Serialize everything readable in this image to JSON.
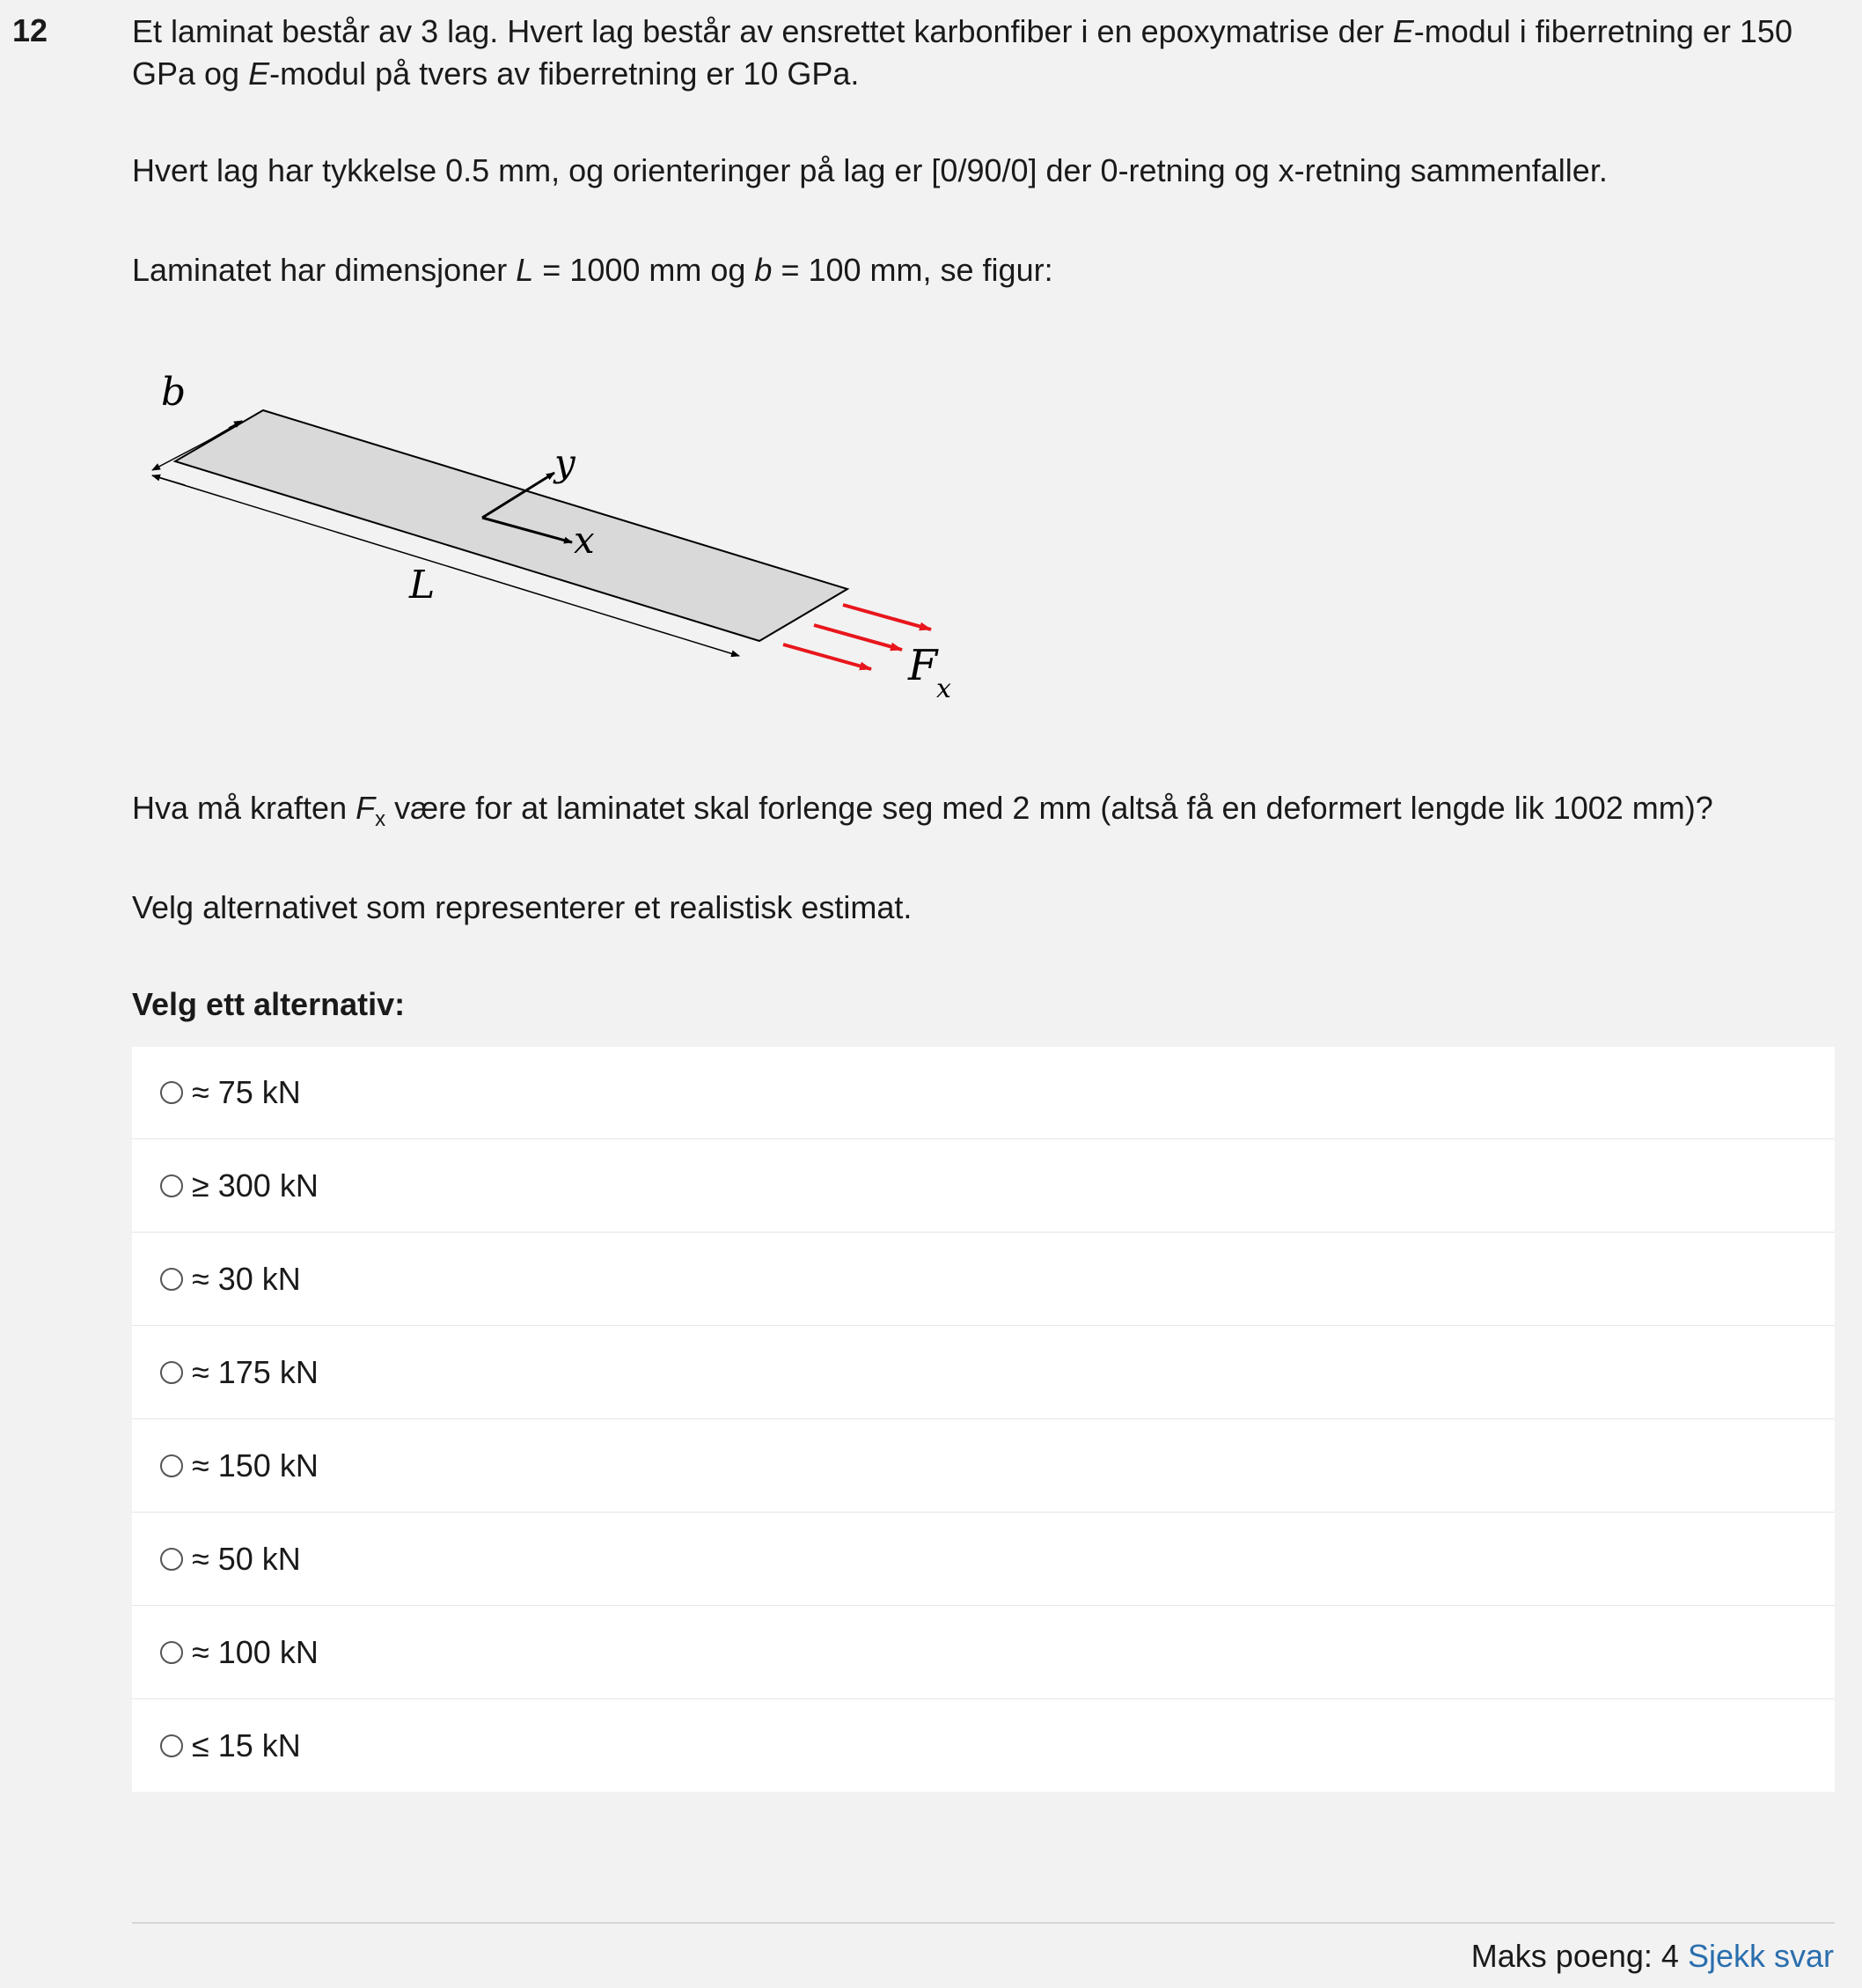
{
  "question": {
    "number": "12",
    "p1": {
      "a": "Et laminat består av 3 lag. Hvert lag består av ensrettet karbonfiber i en epoxymatrise der ",
      "e1": "E",
      "b": "-modul i fiberretning er 150 GPa og ",
      "e2": "E",
      "c": "-modul på tvers av fiberretning er 10 GPa."
    },
    "p2": "Hvert lag har tykkelse 0.5 mm, og orienteringer på lag er [0/90/0] der 0-retning og x-retning sammenfaller.",
    "p3": {
      "a": "Laminatet har dimensjoner ",
      "L": "L",
      "b": " = 1000 mm og ",
      "bvar": "b",
      "c": " = 100 mm, se figur:"
    },
    "p4": {
      "a": "Hva må kraften ",
      "F": "F",
      "sub": "x",
      "b": " være for at laminatet skal forlenge seg med 2 mm (altså få en deformert lengde lik 1002 mm)?"
    },
    "p5": "Velg alternativet som representerer et realistisk estimat.",
    "select_heading": "Velg ett alternativ:"
  },
  "figure": {
    "label_b": "b",
    "label_L": "L",
    "label_x": "x",
    "label_y": "y",
    "label_F": "F",
    "label_F_sub": "x",
    "plate_color": "#d9d9d9",
    "arrow_color": "#e8161c"
  },
  "options": [
    {
      "label": "≈ 75 kN"
    },
    {
      "label": "≥ 300 kN"
    },
    {
      "label": "≈ 30 kN"
    },
    {
      "label": "≈ 175 kN"
    },
    {
      "label": "≈ 150 kN"
    },
    {
      "label": "≈ 50 kN"
    },
    {
      "label": "≈ 100 kN"
    },
    {
      "label": "≤ 15 kN"
    }
  ],
  "footer": {
    "max_points": "Maks poeng: 4",
    "check_answer": "Sjekk svar"
  }
}
